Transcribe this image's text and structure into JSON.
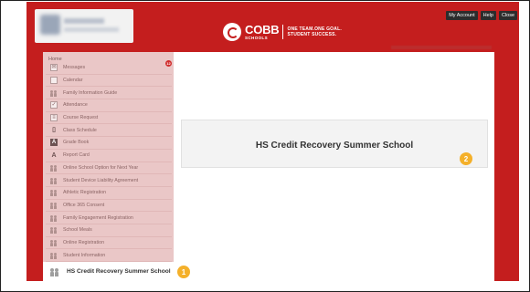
{
  "header": {
    "logo_name": "COBB",
    "logo_sub": "SCHOOLS",
    "tagline_line1": "ONE TEAM.ONE GOAL.",
    "tagline_line2": "STUDENT SUCCESS.",
    "links": [
      "My Account",
      "Help",
      "Close"
    ]
  },
  "sidebar": {
    "home_label": "Home",
    "items": [
      {
        "label": "Messages",
        "icon": "envelope-icon",
        "badge": "12"
      },
      {
        "label": "Calendar",
        "icon": "calendar-icon"
      },
      {
        "label": "Family Information Guide",
        "icon": "people-icon"
      },
      {
        "label": "Attendance",
        "icon": "checkmark-icon"
      },
      {
        "label": "Course Request",
        "icon": "list-icon"
      },
      {
        "label": "Class Schedule",
        "icon": "schedule-icon"
      },
      {
        "label": "Grade Book",
        "icon": "gradebook-icon"
      },
      {
        "label": "Report Card",
        "icon": "report-card-icon"
      },
      {
        "label": "Online School Option for Next Year",
        "icon": "people-icon"
      },
      {
        "label": "Student Device Liability Agreement",
        "icon": "people-icon"
      },
      {
        "label": "Athletic Registration",
        "icon": "people-icon"
      },
      {
        "label": "Office 365 Consent",
        "icon": "people-icon"
      },
      {
        "label": "Family Engagement Registration",
        "icon": "people-icon"
      },
      {
        "label": "School Meals",
        "icon": "people-icon"
      },
      {
        "label": "Online Registration",
        "icon": "people-icon"
      },
      {
        "label": "Student Information",
        "icon": "people-icon"
      }
    ],
    "active_item": {
      "label": "HS Credit Recovery Summer School",
      "icon": "people-icon"
    }
  },
  "main": {
    "panel_title": "HS Credit Recovery Summer School"
  },
  "callouts": {
    "one": "1",
    "two": "2"
  },
  "colors": {
    "brand_red": "#c41e1e",
    "sidebar_bg": "#eac7c7",
    "callout": "#f4b02a"
  }
}
